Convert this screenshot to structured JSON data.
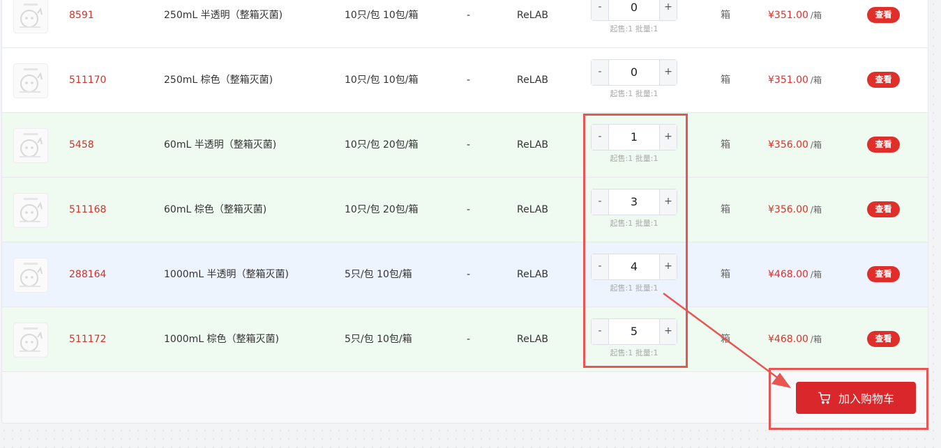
{
  "rows": [
    {
      "code": "8591",
      "name": "250mL 半透明（整箱灭菌)",
      "pack": "10只/包 10包/箱",
      "spec": "-",
      "brand": "ReLAB",
      "qty": "0",
      "hint": "起售:1 批量:1",
      "unit": "箱",
      "price": "¥351.00",
      "per": "/箱",
      "action": "查看",
      "bg": "white"
    },
    {
      "code": "511170",
      "name": "250mL 棕色（整箱灭菌)",
      "pack": "10只/包 10包/箱",
      "spec": "-",
      "brand": "ReLAB",
      "qty": "0",
      "hint": "起售:1 批量:1",
      "unit": "箱",
      "price": "¥351.00",
      "per": "/箱",
      "action": "查看",
      "bg": "white"
    },
    {
      "code": "5458",
      "name": "60mL 半透明（整箱灭菌)",
      "pack": "10只/包 20包/箱",
      "spec": "-",
      "brand": "ReLAB",
      "qty": "1",
      "hint": "起售:1 批量:1",
      "unit": "箱",
      "price": "¥356.00",
      "per": "/箱",
      "action": "查看",
      "bg": "green"
    },
    {
      "code": "511168",
      "name": "60mL 棕色（整箱灭菌)",
      "pack": "10只/包 20包/箱",
      "spec": "-",
      "brand": "ReLAB",
      "qty": "3",
      "hint": "起售:1 批量:1",
      "unit": "箱",
      "price": "¥356.00",
      "per": "/箱",
      "action": "查看",
      "bg": "green"
    },
    {
      "code": "288164",
      "name": "1000mL 半透明（整箱灭菌)",
      "pack": "5只/包 10包/箱",
      "spec": "-",
      "brand": "ReLAB",
      "qty": "4",
      "hint": "起售:1 批量:1",
      "unit": "箱",
      "price": "¥468.00",
      "per": "/箱",
      "action": "查看",
      "bg": "blue"
    },
    {
      "code": "511172",
      "name": "1000mL 棕色（整箱灭菌)",
      "pack": "5只/包 10包/箱",
      "spec": "-",
      "brand": "ReLAB",
      "qty": "5",
      "hint": "起售:1 批量:1",
      "unit": "箱",
      "price": "¥468.00",
      "per": "/箱",
      "action": "查看",
      "bg": "green"
    }
  ],
  "stepper": {
    "minus": "-",
    "plus": "+"
  },
  "cart": {
    "label": "加入购物车",
    "icon": "shopping-cart-icon"
  },
  "colors": {
    "accent": "#e02f2a",
    "highlight": "#e95552",
    "row_selected": "#effbf1",
    "row_hover": "#edf4fd"
  }
}
